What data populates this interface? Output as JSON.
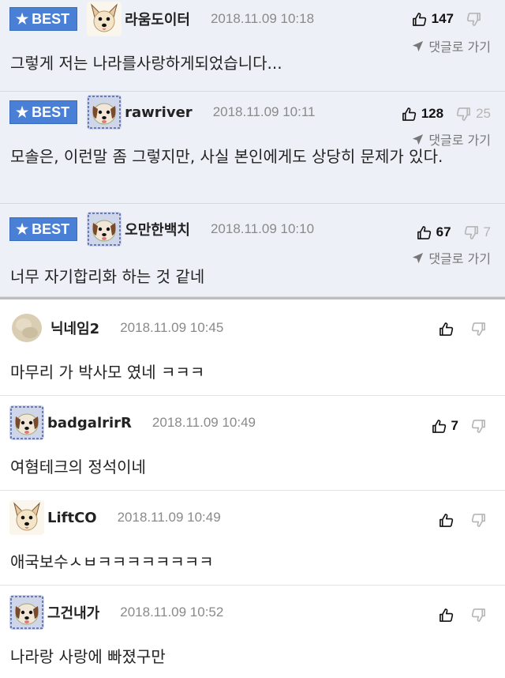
{
  "best_badge": "BEST",
  "reply_label": "댓글로 가기",
  "best_comments": [
    {
      "nick": "라움도이터",
      "time": "2018.11.09 10:18",
      "up": "147",
      "down": "",
      "text": "그렇게 저는 나라를사랑하게되었습니다..."
    },
    {
      "nick": "rawriver",
      "time": "2018.11.09 10:11",
      "up": "128",
      "down": "25",
      "text": "모솔은, 이런말 좀 그렇지만, 사실 본인에게도 상당히 문제가 있다."
    },
    {
      "nick": "오만한백치",
      "time": "2018.11.09 10:10",
      "up": "67",
      "down": "7",
      "text": "너무 자기합리화 하는 것 같네"
    }
  ],
  "comments": [
    {
      "nick": "닉네임2",
      "time": "2018.11.09 10:45",
      "up": "",
      "down": "",
      "text": "마무리 가 박사모 였네 ㅋㅋㅋ"
    },
    {
      "nick": "badgalrirR",
      "time": "2018.11.09 10:49",
      "up": "7",
      "down": "",
      "text": "여혐테크의 정석이네"
    },
    {
      "nick": "LiftCO",
      "time": "2018.11.09 10:49",
      "up": "",
      "down": "",
      "text": "애국보수ㅅㅂㅋㅋㅋㅋㅋㅋㅋㅋ"
    },
    {
      "nick": "그건내가",
      "time": "2018.11.09 10:52",
      "up": "",
      "down": "",
      "text": "나라랑 사랑에 빠졌구만"
    }
  ],
  "colors": {
    "best_bg": "#eef0f8",
    "badge": "#4a7fd6"
  }
}
